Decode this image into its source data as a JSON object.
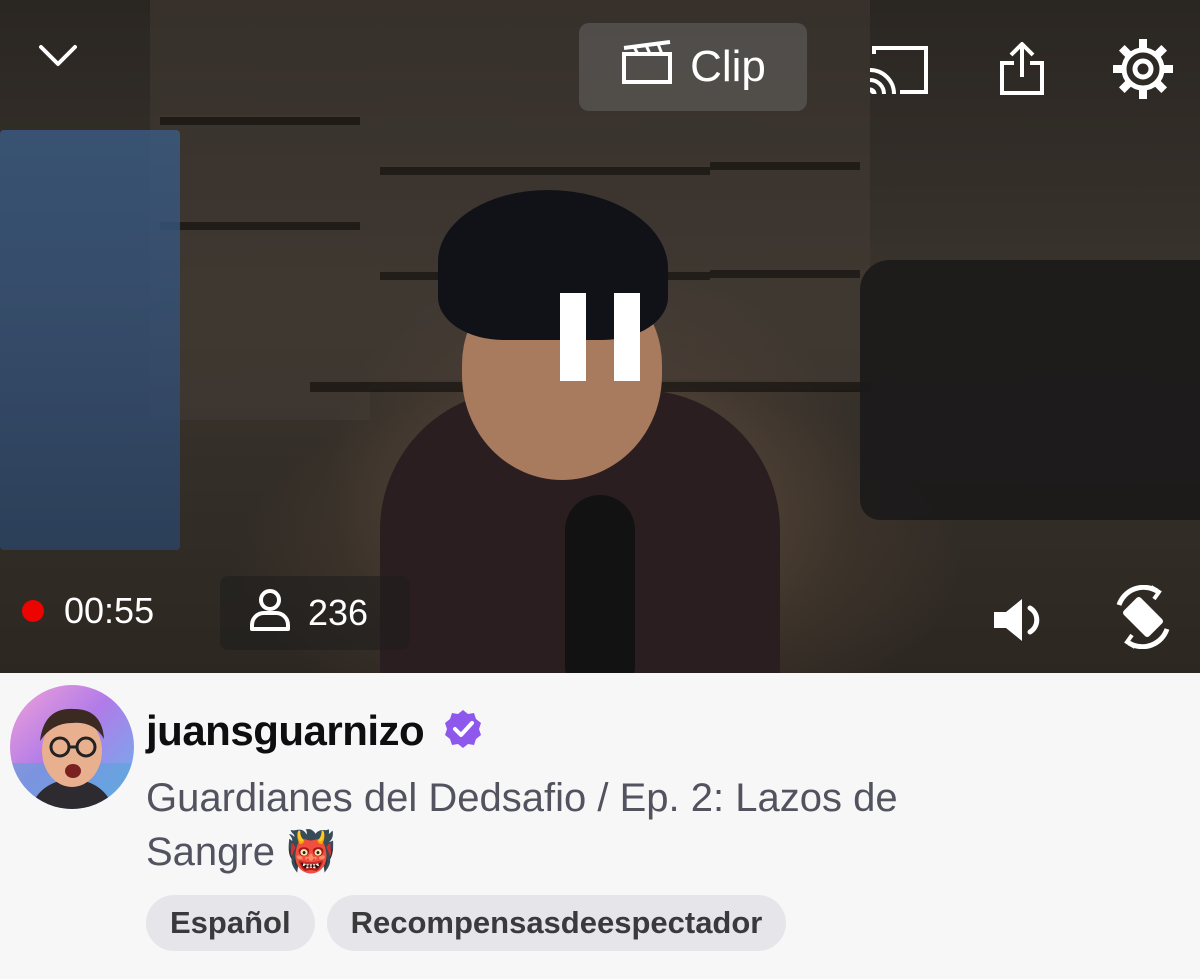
{
  "player": {
    "clip_label": "Clip",
    "elapsed_time": "00:55",
    "viewer_count": "236",
    "icons": {
      "collapse": "chevron-down-icon",
      "clip": "clapperboard-icon",
      "cast": "cast-icon",
      "share": "share-icon",
      "settings": "gear-icon",
      "pause": "pause-icon",
      "live": "live-dot-icon",
      "viewers": "person-icon",
      "volume": "speaker-icon",
      "rotate": "rotate-screen-icon"
    },
    "live_color": "#eb0400"
  },
  "channel": {
    "name": "juansguarnizo",
    "verified_color": "#8f58ec",
    "title": "Guardianes del Dedsafio / Ep. 2: Lazos de Sangre",
    "title_emoji": "👹",
    "tags": [
      "Español",
      "Recompensasdeespectador"
    ]
  }
}
